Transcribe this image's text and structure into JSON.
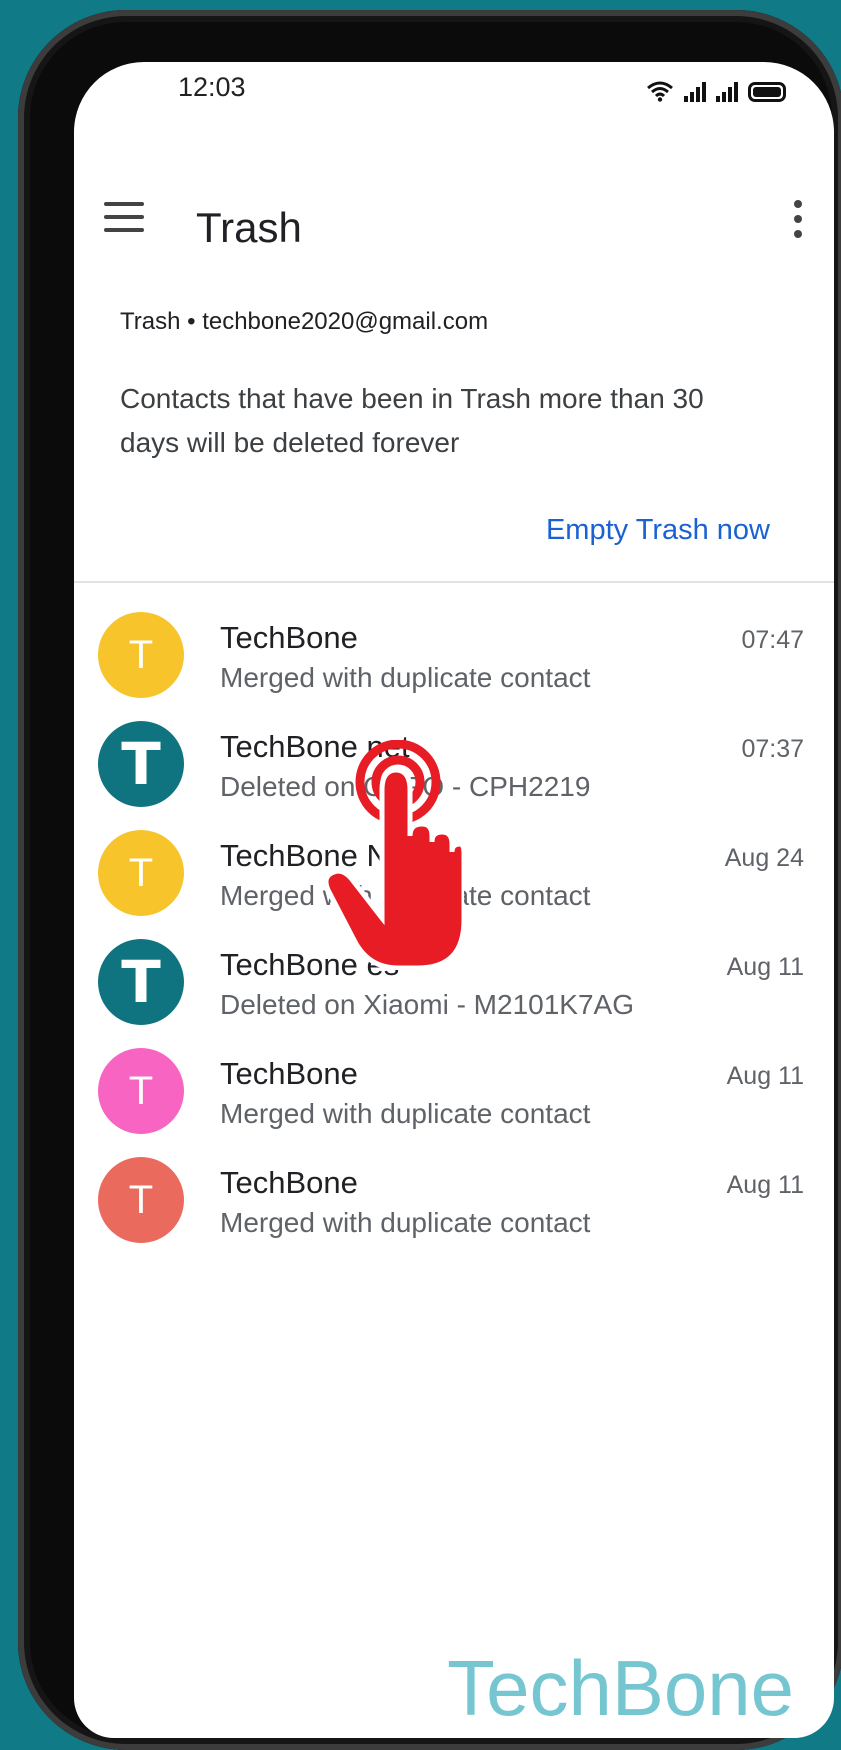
{
  "status_bar": {
    "time": "12:03"
  },
  "toolbar": {
    "title": "Trash"
  },
  "info": {
    "header": "Trash • techbone2020@gmail.com",
    "message": "Contacts that have been in Trash more than 30 days will be deleted forever",
    "empty_action": "Empty Trash now"
  },
  "contacts": [
    {
      "initial": "T",
      "name": "TechBone",
      "detail": "Merged with duplicate contact",
      "time": "07:47",
      "avatar_color": "#f7c42c"
    },
    {
      "initial": "T",
      "name": "TechBone net",
      "detail": "Deleted on OPPO - CPH2219",
      "time": "07:37",
      "avatar_color": "#0f7480"
    },
    {
      "initial": "T",
      "name": "TechBone Net",
      "detail": "Merged with duplicate contact",
      "time": "Aug 24",
      "avatar_color": "#f7c42c"
    },
    {
      "initial": "T",
      "name": "TechBone es",
      "detail": "Deleted on Xiaomi - M2101K7AG",
      "time": "Aug 11",
      "avatar_color": "#0f7480"
    },
    {
      "initial": "T",
      "name": "TechBone",
      "detail": "Merged with duplicate contact",
      "time": "Aug 11",
      "avatar_color": "#f764c2"
    },
    {
      "initial": "T",
      "name": "TechBone",
      "detail": "Merged with duplicate contact",
      "time": "Aug 11",
      "avatar_color": "#ea6a5e"
    }
  ],
  "watermark": "TechBone",
  "icons": {
    "menu": "hamburger-menu-icon",
    "more": "more-vert-icon",
    "wifi": "wifi-icon",
    "signal": "signal-icon",
    "battery": "battery-icon",
    "pointer": "tap-hand-icon"
  },
  "colors": {
    "accent": "#1a62d2",
    "background": "#107a86",
    "tap_indicator": "#e81c24"
  }
}
